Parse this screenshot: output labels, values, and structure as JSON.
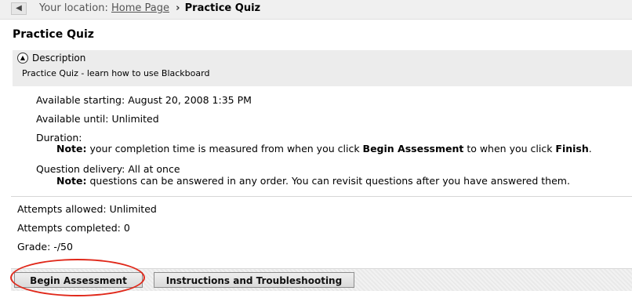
{
  "breadcrumb": {
    "prefix": "Your location:",
    "home": "Home Page",
    "separator": "›",
    "current": "Practice Quiz"
  },
  "page": {
    "title": "Practice Quiz"
  },
  "description": {
    "header": "Description",
    "text": "Practice Quiz - learn how to use Blackboard"
  },
  "details": {
    "available_starting_label": "Available starting:",
    "available_starting_value": "August 20, 2008 1:35 PM",
    "available_until_label": "Available until:",
    "available_until_value": "Unlimited",
    "duration_label": "Duration:",
    "duration_note_label": "Note:",
    "duration_note_text1": "your completion time is measured from when you click",
    "duration_note_bold1": "Begin Assessment",
    "duration_note_text2": "to when you click",
    "duration_note_bold2": "Finish",
    "duration_note_end": ".",
    "question_delivery_label": "Question delivery:",
    "question_delivery_value": "All at once",
    "delivery_note_label": "Note:",
    "delivery_note_text": "questions can be answered in any order. You can revisit questions after you have answered them."
  },
  "summary": {
    "attempts_allowed_label": "Attempts allowed:",
    "attempts_allowed_value": "Unlimited",
    "attempts_completed_label": "Attempts completed:",
    "attempts_completed_value": "0",
    "grade_label": "Grade:",
    "grade_value": "-/50"
  },
  "buttons": {
    "begin": "Begin Assessment",
    "instructions": "Instructions and Troubleshooting"
  },
  "colors": {
    "highlight": "#e0281a",
    "panel_bg": "#ececec"
  },
  "icons": {
    "back": "chevron-left-icon",
    "collapse": "collapse-up-icon"
  }
}
